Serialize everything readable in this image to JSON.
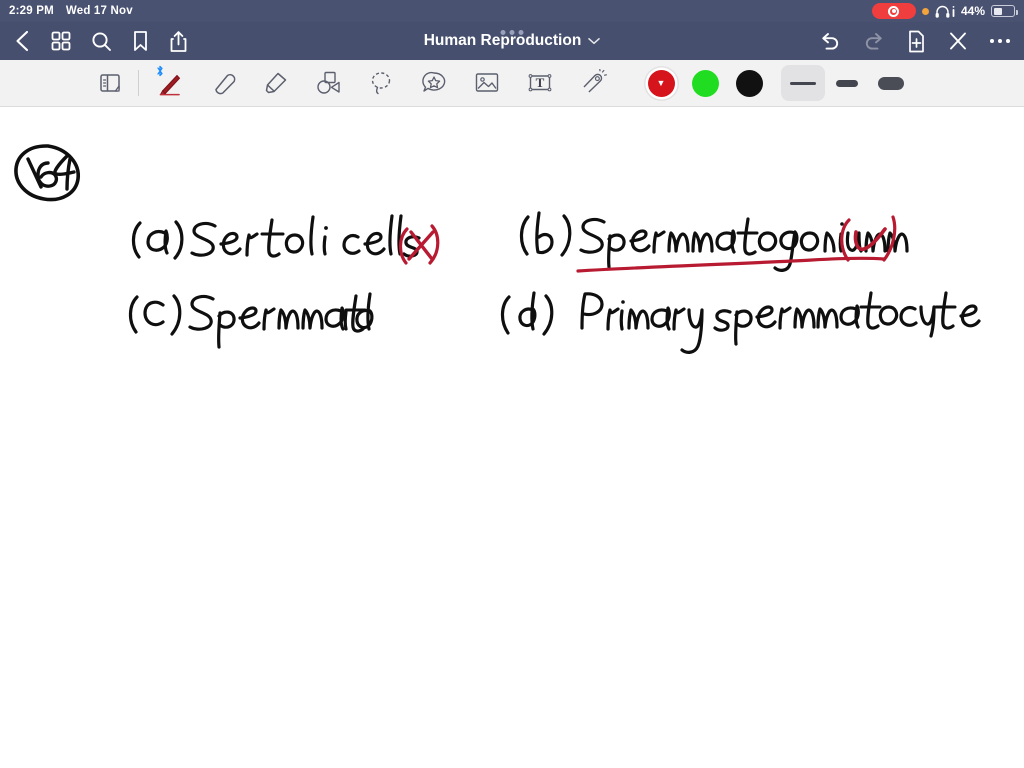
{
  "status_bar": {
    "time": "2:29 PM",
    "date": "Wed 17 Nov",
    "battery_percent": "44%",
    "recording_icon": "record-icon",
    "orange_dot_icon": "microphone-in-use-icon",
    "headphones_icon": "headphones-icon",
    "battery_icon": "battery-icon"
  },
  "nav": {
    "title": "Human Reproduction",
    "title_chevron_icon": "chevron-down-icon",
    "multitask_icon": "multitask-handle-icon",
    "left_icons": [
      {
        "name": "back-icon",
        "label": "Back"
      },
      {
        "name": "grid-icon",
        "label": "Page thumbnails"
      },
      {
        "name": "search-icon",
        "label": "Search"
      },
      {
        "name": "bookmark-icon",
        "label": "Bookmark"
      },
      {
        "name": "share-icon",
        "label": "Share"
      }
    ],
    "right_icons": [
      {
        "name": "undo-icon",
        "label": "Undo",
        "enabled": "true"
      },
      {
        "name": "redo-icon",
        "label": "Redo",
        "enabled": "false"
      },
      {
        "name": "add-page-icon",
        "label": "Add page",
        "enabled": "true"
      },
      {
        "name": "close-icon",
        "label": "Close",
        "enabled": "true"
      },
      {
        "name": "more-icon",
        "label": "More",
        "enabled": "true"
      }
    ]
  },
  "toolbar": {
    "tools": [
      {
        "name": "page-layers-icon",
        "label": "Page layers"
      },
      {
        "name": "pen-icon",
        "label": "Pen",
        "selected": "true",
        "bluetooth_badge": "bluetooth-icon"
      },
      {
        "name": "eraser-icon",
        "label": "Eraser"
      },
      {
        "name": "highlighter-icon",
        "label": "Highlighter"
      },
      {
        "name": "shapes-icon",
        "label": "Shapes"
      },
      {
        "name": "lasso-icon",
        "label": "Lasso select"
      },
      {
        "name": "sticker-icon",
        "label": "Stickers"
      },
      {
        "name": "image-icon",
        "label": "Insert image"
      },
      {
        "name": "text-box-icon",
        "label": "Text box"
      },
      {
        "name": "laser-pointer-icon",
        "label": "Laser pointer"
      }
    ],
    "colors": [
      {
        "name": "color-swatch-red",
        "hex": "#d6141c",
        "selected": "true"
      },
      {
        "name": "color-swatch-green",
        "hex": "#21dd21",
        "selected": "false"
      },
      {
        "name": "color-swatch-black",
        "hex": "#111111",
        "selected": "false"
      }
    ],
    "stroke_widths": [
      {
        "name": "stroke-width-thin",
        "label": "Thin",
        "selected": "true"
      },
      {
        "name": "stroke-width-medium",
        "label": "Medium",
        "selected": "false"
      },
      {
        "name": "stroke-width-thick",
        "label": "Thick",
        "selected": "false"
      }
    ]
  },
  "canvas": {
    "question_number": "164",
    "ink_colors": {
      "black": "#100f0f",
      "red": "#b81a31"
    },
    "options": [
      {
        "id": "option-a",
        "text": "(a) Sertoli cells",
        "mark": "(X)",
        "mark_color": "#b81a31",
        "underlined": "false"
      },
      {
        "id": "option-b",
        "text": "(b) Spermatogonium",
        "mark": "(✓)",
        "mark_color": "#b81a31",
        "underlined": "true"
      },
      {
        "id": "option-c",
        "text": "(c) Spermatid",
        "mark": "",
        "mark_color": "",
        "underlined": "false"
      },
      {
        "id": "option-d",
        "text": "(d) Primary spermatocyte",
        "mark": "",
        "mark_color": "",
        "underlined": "false"
      }
    ]
  }
}
